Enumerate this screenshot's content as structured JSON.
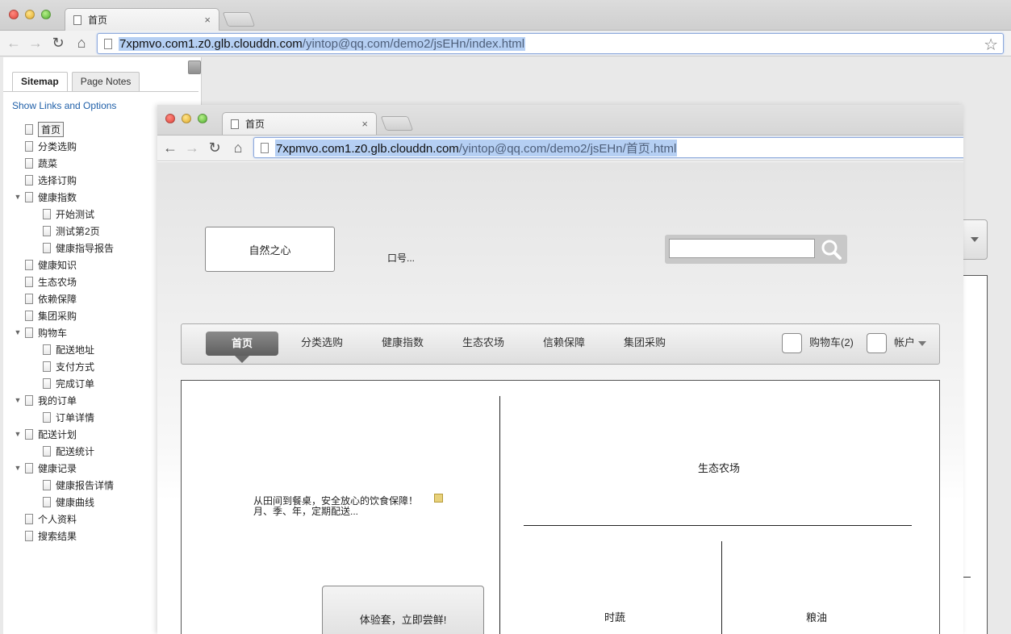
{
  "outer_browser": {
    "tab": {
      "title": "首页",
      "close": "×"
    },
    "url": {
      "host": "7xpmvo.com1.z0.glb.clouddn.com",
      "path": "/yintop@qq.com/demo2/jsEHn/index.html"
    },
    "nav": {
      "back": "←",
      "forward": "→",
      "reload": "↻",
      "home": "⌂",
      "star": "☆"
    }
  },
  "sidebar": {
    "tabs": [
      {
        "label": "Sitemap",
        "active": true
      },
      {
        "label": "Page Notes",
        "active": false
      }
    ],
    "show_links": "Show Links and Options",
    "tree": [
      {
        "label": "首页",
        "level": 0,
        "toggle": "",
        "selected": true
      },
      {
        "label": "分类选购",
        "level": 0,
        "toggle": ""
      },
      {
        "label": "蔬菜",
        "level": 0,
        "toggle": ""
      },
      {
        "label": "选择订购",
        "level": 0,
        "toggle": ""
      },
      {
        "label": "健康指数",
        "level": 0,
        "toggle": "▼"
      },
      {
        "label": "开始测试",
        "level": 1,
        "toggle": ""
      },
      {
        "label": "测试第2页",
        "level": 1,
        "toggle": ""
      },
      {
        "label": "健康指导报告",
        "level": 1,
        "toggle": ""
      },
      {
        "label": "健康知识",
        "level": 0,
        "toggle": ""
      },
      {
        "label": "生态农场",
        "level": 0,
        "toggle": ""
      },
      {
        "label": "依赖保障",
        "level": 0,
        "toggle": ""
      },
      {
        "label": "集团采购",
        "level": 0,
        "toggle": ""
      },
      {
        "label": "购物车",
        "level": 0,
        "toggle": "▼"
      },
      {
        "label": "配送地址",
        "level": 1,
        "toggle": ""
      },
      {
        "label": "支付方式",
        "level": 1,
        "toggle": ""
      },
      {
        "label": "完成订单",
        "level": 1,
        "toggle": ""
      },
      {
        "label": "我的订单",
        "level": 0,
        "toggle": "▼"
      },
      {
        "label": "订单详情",
        "level": 1,
        "toggle": ""
      },
      {
        "label": "配送计划",
        "level": 0,
        "toggle": "▼"
      },
      {
        "label": "配送统计",
        "level": 1,
        "toggle": ""
      },
      {
        "label": "健康记录",
        "level": 0,
        "toggle": "▼"
      },
      {
        "label": "健康报告详情",
        "level": 1,
        "toggle": ""
      },
      {
        "label": "健康曲线",
        "level": 1,
        "toggle": ""
      },
      {
        "label": "个人资料",
        "level": 0,
        "toggle": ""
      },
      {
        "label": "搜索结果",
        "level": 0,
        "toggle": ""
      }
    ]
  },
  "inner_browser": {
    "tab": {
      "title": "首页",
      "close": "×"
    },
    "url": {
      "host": "7xpmvo.com1.z0.glb.clouddn.com",
      "path": "/yintop@qq.com/demo2/jsEHn/首页.html"
    },
    "nav": {
      "back": "←",
      "forward": "→",
      "reload": "↻",
      "home": "⌂"
    }
  },
  "page": {
    "logo": "自然之心",
    "slogan": "口号...",
    "search": {
      "placeholder": ""
    },
    "nav": [
      "首页",
      "分类选购",
      "健康指数",
      "生态农场",
      "信赖保障",
      "集团采购"
    ],
    "cart": "购物车(2)",
    "account": "帐户",
    "hero_line1": "从田间到餐桌，安全放心的饮食保障！",
    "hero_line2": "月、季、年，定期配送...",
    "cta": "体验套，立即尝鲜!",
    "farm": "生态农场",
    "veg": "时蔬",
    "grain": "粮油"
  }
}
